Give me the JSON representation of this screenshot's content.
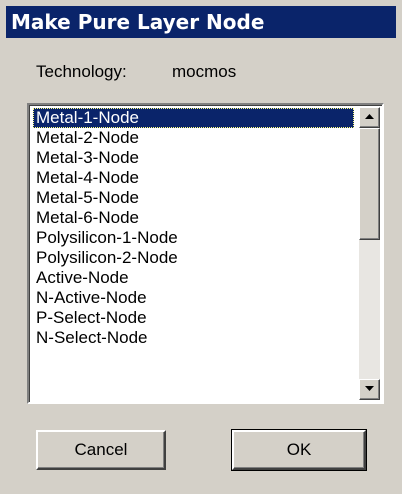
{
  "window": {
    "title": "Make Pure Layer Node"
  },
  "technology": {
    "label": "Technology:",
    "value": "mocmos"
  },
  "list": {
    "items": [
      "Metal-1-Node",
      "Metal-2-Node",
      "Metal-3-Node",
      "Metal-4-Node",
      "Metal-5-Node",
      "Metal-6-Node",
      "Polysilicon-1-Node",
      "Polysilicon-2-Node",
      "Active-Node",
      "N-Active-Node",
      "P-Select-Node",
      "N-Select-Node"
    ],
    "selected_index": 0
  },
  "buttons": {
    "cancel": "Cancel",
    "ok": "OK"
  },
  "icons": {
    "scroll_up": "triangle-up-icon",
    "scroll_down": "triangle-down-icon"
  },
  "colors": {
    "title_bar": "#0a246a",
    "selection": "#0a246a",
    "face": "#d4d0c8"
  }
}
